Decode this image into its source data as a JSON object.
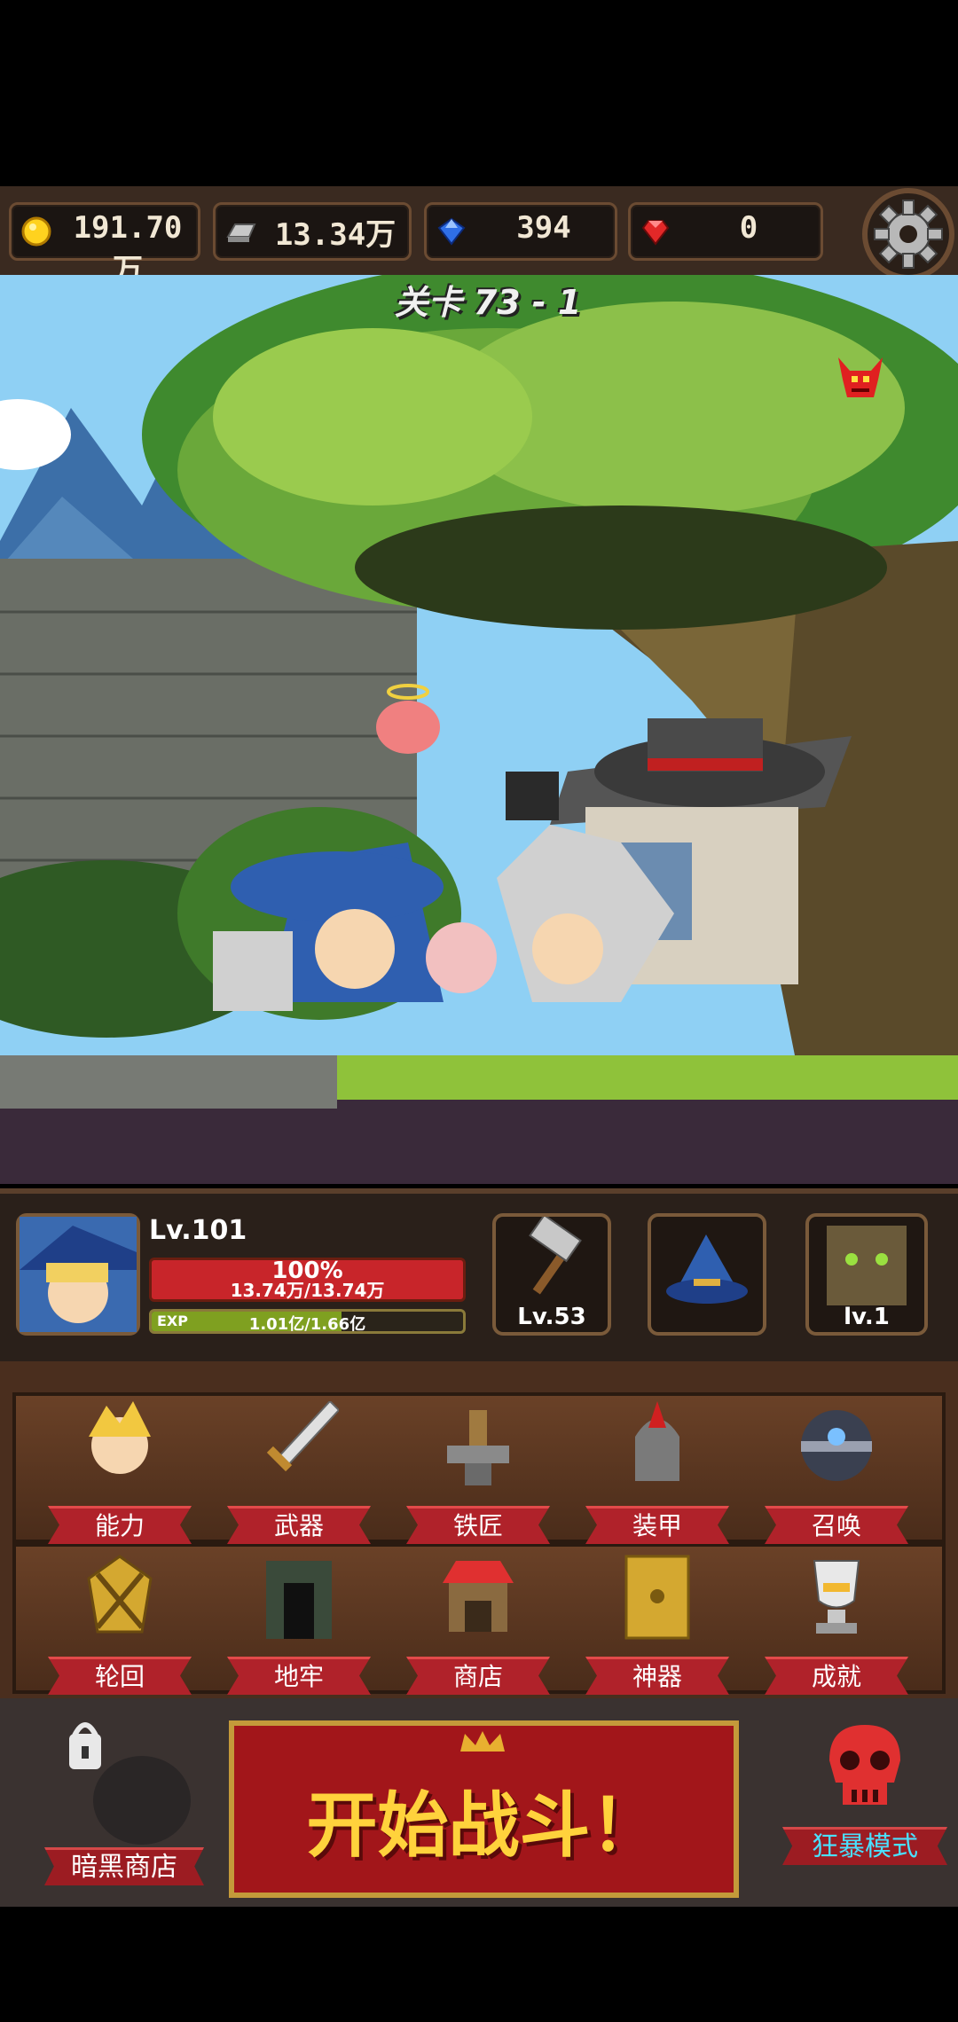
{
  "resources": {
    "gold": "191.70万",
    "iron": "13.34万",
    "gem": "394",
    "ruby": "0"
  },
  "stage": {
    "label": "关卡 73 - 1"
  },
  "hero": {
    "level": "Lv.101",
    "hp_percent_text": "100%",
    "hp_text": "13.74万/13.74万",
    "exp_label": "EXP",
    "exp_text": "1.01亿/1.66亿",
    "exp_fraction": 0.61
  },
  "equipment": {
    "weapon_level": "Lv.53",
    "relic_level": "lv.1"
  },
  "menu": {
    "row1": [
      "能力",
      "武器",
      "铁匠",
      "装甲",
      "召唤"
    ],
    "row2": [
      "轮回",
      "地牢",
      "商店",
      "神器",
      "成就"
    ]
  },
  "bottom": {
    "dark_shop": "暗黑商店",
    "start_battle": "开始战斗！",
    "berserk": "狂暴模式"
  },
  "icons": [
    "gold-coin-icon",
    "iron-ingot-icon",
    "blue-gem-icon",
    "red-ruby-icon",
    "settings-gear-icon",
    "boss-demon-icon",
    "lock-icon",
    "skull-icon"
  ]
}
